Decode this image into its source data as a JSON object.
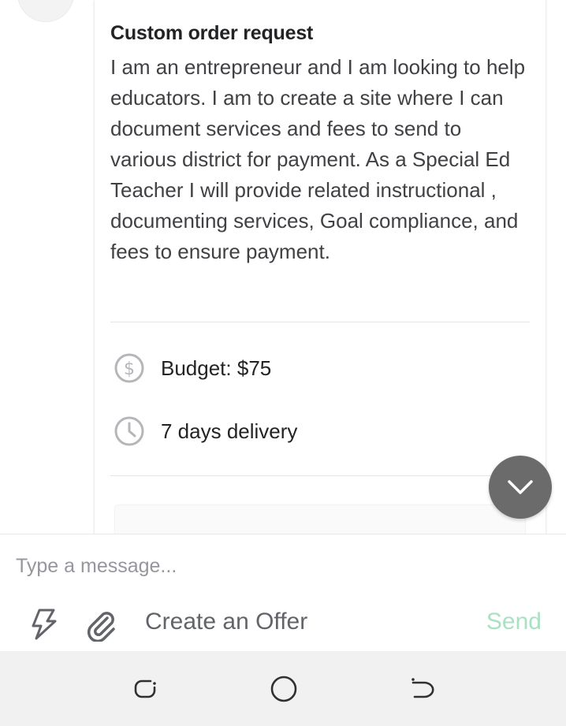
{
  "card": {
    "title": "Custom order request",
    "description": "I am an entrepreneur and I am looking to help educators.  I am to create a site where I can document services and fees to send to various district for payment. As a Special Ed Teacher I will provide related instructional , documenting services, Goal compliance, and fees to ensure payment.",
    "budget": "Budget: $75",
    "delivery": "7 days delivery"
  },
  "composer": {
    "placeholder": "Type a message...",
    "create_offer_label": "Create an Offer",
    "send_label": "Send"
  },
  "colors": {
    "send_disabled": "#a8e2c2",
    "scroll_button": "#6b6b6b",
    "nav_bar": "#f1f1f1"
  },
  "icons": {
    "budget": "dollar-circle-icon",
    "delivery": "clock-icon",
    "quick_responses": "lightning-icon",
    "attach": "paperclip-icon",
    "scroll_down": "chevron-down-icon",
    "nav_recents": "recents-icon",
    "nav_home": "home-circle-icon",
    "nav_back": "back-icon"
  }
}
